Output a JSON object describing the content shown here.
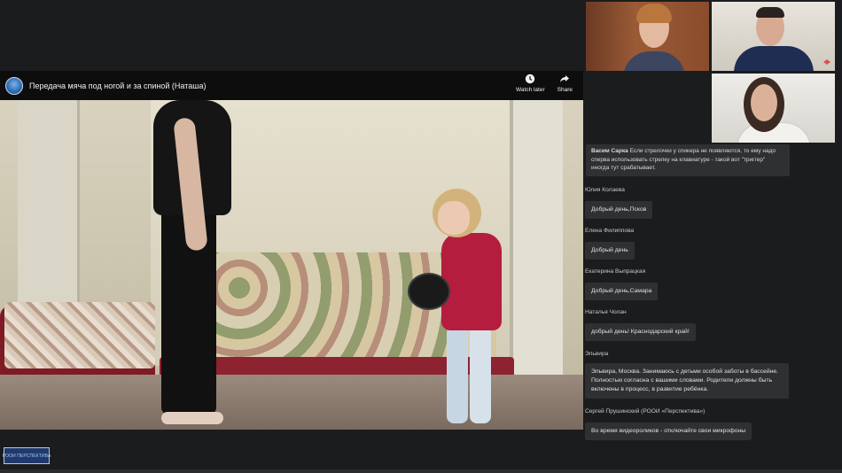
{
  "player": {
    "title": "Передача мяча под ногой и за спиной (Наташа)",
    "watch_later_label": "Watch later",
    "share_label": "Share"
  },
  "participants": [
    {
      "tile": "participant-video-1"
    },
    {
      "tile": "participant-video-2"
    },
    {
      "tile": "participant-video-3"
    }
  ],
  "chat": {
    "first_message": {
      "author": "Васим Сарка",
      "text": "Если стрелочки у спикера не появляются, то ему надо сперва использовать стрелку на клавиатуре - такой вот \"триггер\" иногда тут срабатывает."
    },
    "messages": [
      {
        "author": "Юлия Колаева",
        "text": "Добрый день,Псков"
      },
      {
        "author": "Елена Филиппова",
        "text": "Добрый день"
      },
      {
        "author": "Екатерина Выпрацкая",
        "text": "Добрый день,Самара"
      },
      {
        "author": "Наталья Чолан",
        "text": "добрый день! Краснодарский край!"
      },
      {
        "author": "Эльвира",
        "text": "Эльвира, Москва. Занимаюсь с детьми особой заботы в бассейне. Полностью согласна с вашими словами. Родители должны быть включены в процесс, в развитие ребёнка."
      },
      {
        "author": "Сергей Прушинский (РООИ «Перспектива»)",
        "text": "Во время видеороликов - отключайте свои микрофоны"
      }
    ]
  },
  "footer": {
    "logo_text": "РООИ ПЕРСПЕКТИВА"
  },
  "colors": {
    "background": "#1b1c1d",
    "bubble": "#2f3032"
  }
}
